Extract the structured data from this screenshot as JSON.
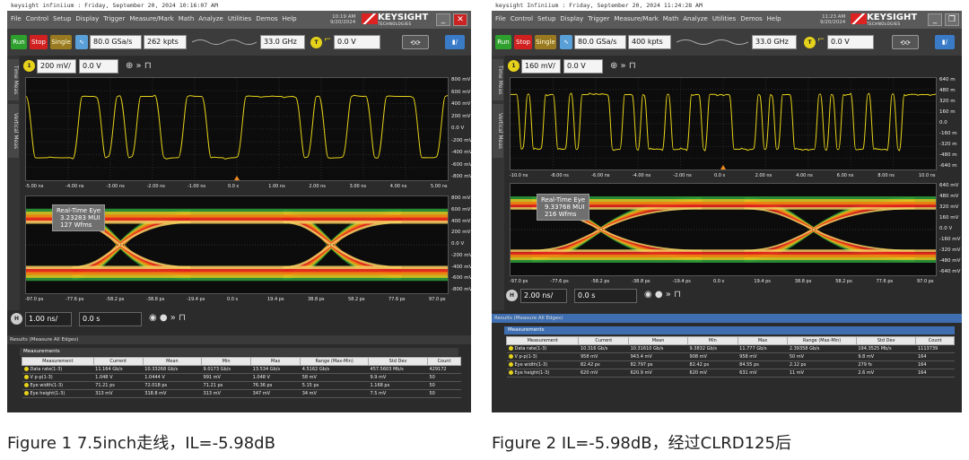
{
  "figures": [
    {
      "header": "keysight infiniium : Friday, September 20, 2024 10:16:07 AM",
      "menu": [
        "File",
        "Control",
        "Setup",
        "Display",
        "Trigger",
        "Measure/Mark",
        "Math",
        "Analyze",
        "Utilities",
        "Demos",
        "Help"
      ],
      "clock": {
        "time": "10:19 AM",
        "date": "9/20/2024"
      },
      "brand": {
        "name": "KEYSIGHT",
        "sub": "TECHNOLOGIES"
      },
      "toolbar": {
        "run": "Run",
        "stop": "Stop",
        "single": "Single",
        "sample_rate": "80.0 GSa/s",
        "points": "262 kpts",
        "bandwidth": "33.0 GHz",
        "trigger_level": "0.0 V"
      },
      "channel": {
        "number": "1",
        "scale": "200 mV/",
        "offset": "0.0 V"
      },
      "side_tabs": [
        "Time Meas",
        "Vertical Meas"
      ],
      "waveform_y": [
        "800 mV",
        "600 mV",
        "400 mV",
        "200 mV",
        "0.0 V",
        "-200 mV",
        "-400 mV",
        "-600 mV",
        "-800 mV"
      ],
      "waveform_x": [
        "-5.00 ns",
        "-4.00 ns",
        "-3.00 ns",
        "-2.00 ns",
        "-1.00 ns",
        "0.0 s",
        "1.00 ns",
        "2.00 ns",
        "3.00 ns",
        "4.00 ns",
        "5.00 ns"
      ],
      "eye_y": [
        "800 mV",
        "600 mV",
        "400 mV",
        "200 mV",
        "0.0 V",
        "-200 mV",
        "-400 mV",
        "-600 mV",
        "-800 mV"
      ],
      "eye_x": [
        "-97.0 ps",
        "-77.6 ps",
        "-58.2 ps",
        "-38.8 ps",
        "-19.4 ps",
        "0.0 s",
        "19.4 ps",
        "38.8 ps",
        "58.2 ps",
        "77.6 ps",
        "97.0 ps"
      ],
      "eye_label": {
        "title": "Real-Time Eye",
        "mui": "3.23283 MUI",
        "wfms": "127 Wfms"
      },
      "timebase": {
        "scale": "1.00 ns/",
        "delay": "0.0 s"
      },
      "results_title": "Results  (Measure All Edges)",
      "measurements_title": "Measurements",
      "columns": [
        "Measurement",
        "Current",
        "Mean",
        "Min",
        "Max",
        "Range (Max-Min)",
        "Std Dev",
        "Count"
      ],
      "rows": [
        [
          "Data rate(1-3)",
          "11.164 Gb/s",
          "10.33268 Gb/s",
          "9.0173 Gb/s",
          "13.534 Gb/s",
          "4.5162 Gb/s",
          "457.5603 Mb/s",
          "429172"
        ],
        [
          "V p-p(1-3)",
          "1.048 V",
          "1.0444 V",
          "991 mV",
          "1.048 V",
          "58 mV",
          "9.9 mV",
          "50"
        ],
        [
          "Eye width(1-3)",
          "71.21 ps",
          "72.018 ps",
          "71.21 ps",
          "76.36 ps",
          "5.15 ps",
          "1.168 ps",
          "50"
        ],
        [
          "Eye height(1-3)",
          "313 mV",
          "318.8 mV",
          "313 mV",
          "347 mV",
          "34 mV",
          "7.5 mV",
          "50"
        ]
      ],
      "caption": "Figure 1 7.5inch走线，IL=-5.98dB"
    },
    {
      "header": "keysight Infiniium : Friday, September 20, 2024 11:24:28 AM",
      "menu": [
        "File",
        "Control",
        "Setup",
        "Display",
        "Trigger",
        "Measure/Mark",
        "Math",
        "Analyze",
        "Utilities",
        "Demos",
        "Help"
      ],
      "clock": {
        "time": "11:23 AM",
        "date": "9/20/2024"
      },
      "brand": {
        "name": "KEYSIGHT",
        "sub": "TECHNOLOGIES"
      },
      "toolbar": {
        "run": "Run",
        "stop": "Stop",
        "single": "Single",
        "sample_rate": "80.0 GSa/s",
        "points": "400 kpts",
        "bandwidth": "33.0 GHz",
        "trigger_level": "0.0 V"
      },
      "channel": {
        "number": "1",
        "scale": "160 mV/",
        "offset": "0.0 V"
      },
      "side_tabs": [
        "Time Meas",
        "Vertical Meas"
      ],
      "waveform_y": [
        "640 m",
        "480 m",
        "320 m",
        "160 m",
        "0.0",
        "-160 m",
        "-320 m",
        "-480 m",
        "-640 m"
      ],
      "waveform_x": [
        "-10.0 ns",
        "-8.00 ns",
        "-6.00 ns",
        "-4.00 ns",
        "-2.00 ns",
        "0.0 s",
        "2.00 ns",
        "4.00 ns",
        "6.00 ns",
        "8.00 ns",
        "10.0 ns"
      ],
      "eye_y": [
        "640 mV",
        "480 mV",
        "320 mV",
        "160 mV",
        "0.0 V",
        "-160 mV",
        "-320 mV",
        "-480 mV",
        "-640 mV"
      ],
      "eye_x": [
        "-97.0 ps",
        "-77.6 ps",
        "-58.2 ps",
        "-38.8 ps",
        "-19.4 ps",
        "0.0 s",
        "19.4 ps",
        "38.8 ps",
        "58.2 ps",
        "77.6 ps",
        "97.0 ps"
      ],
      "eye_label": {
        "title": "Real-Time Eye",
        "mui": "9.33768 MUI",
        "wfms": "216 Wfms"
      },
      "timebase": {
        "scale": "2.00 ns/",
        "delay": "0.0 s"
      },
      "results_title": "Results  (Measure All Edges)",
      "measurements_title": "Measurements",
      "columns": [
        "Measurement",
        "Current",
        "Mean",
        "Min",
        "Max",
        "Range (Max-Min)",
        "Std Dev",
        "Count"
      ],
      "rows": [
        [
          "Data rate(1-3)",
          "10.316 Gb/s",
          "10.31610 Gb/s",
          "9.3832 Gb/s",
          "11.777 Gb/s",
          "2.39358 Gb/s",
          "194.3525 Mb/s",
          "1113739"
        ],
        [
          "V p-p(1-3)",
          "958 mV",
          "943.4 mV",
          "908 mV",
          "958 mV",
          "50 mV",
          "9.8 mV",
          "164"
        ],
        [
          "Eye width(1-3)",
          "82.42 ps",
          "82.797 ps",
          "82.42 ps",
          "84.55 ps",
          "2.12 ps",
          "279 fs",
          "164"
        ],
        [
          "Eye height(1-3)",
          "620 mV",
          "620.9 mV",
          "620 mV",
          "631 mV",
          "11 mV",
          "2.6 mV",
          "164"
        ]
      ],
      "caption": "Figure 2 IL=-5.98dB，经过CLRD125后"
    }
  ]
}
